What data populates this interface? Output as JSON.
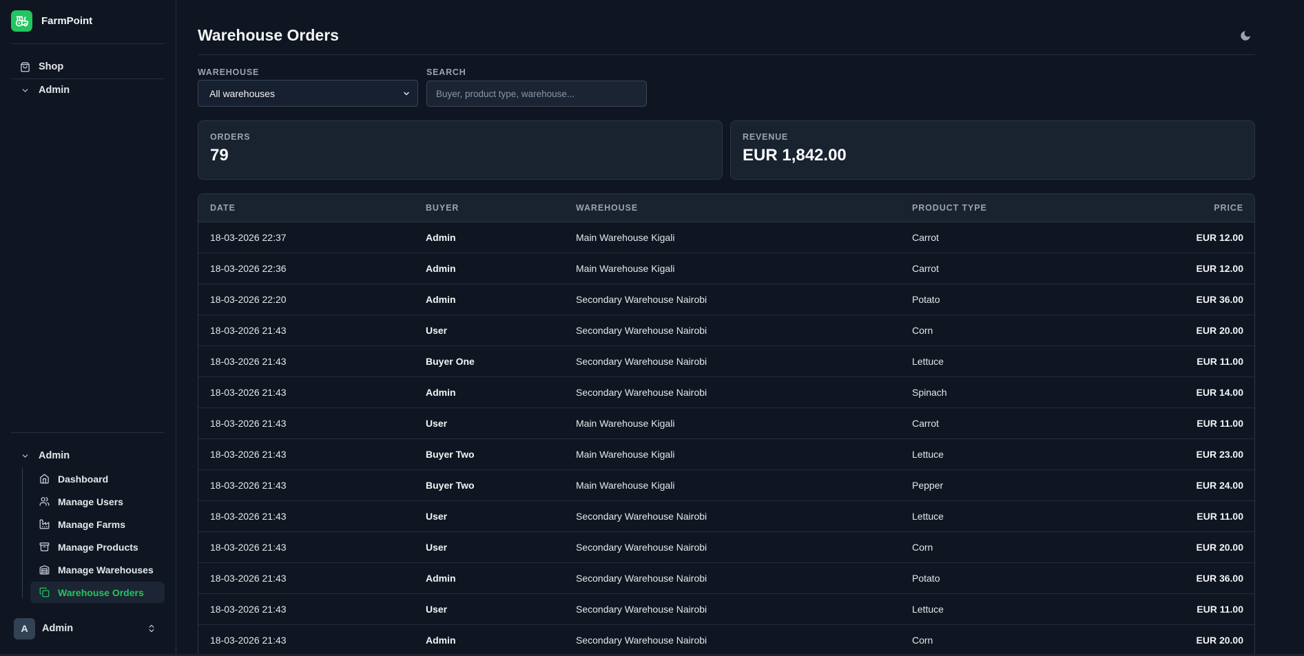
{
  "brand": {
    "name": "FarmPoint"
  },
  "sidebar": {
    "top_items": [
      {
        "label": "Shop"
      },
      {
        "label": "Admin"
      }
    ],
    "section_label": "Admin",
    "sub_items": [
      {
        "label": "Dashboard"
      },
      {
        "label": "Manage Users"
      },
      {
        "label": "Manage Farms"
      },
      {
        "label": "Manage Products"
      },
      {
        "label": "Manage Warehouses"
      },
      {
        "label": "Warehouse Orders"
      }
    ],
    "user": {
      "initial": "A",
      "name": "Admin"
    }
  },
  "page": {
    "title": "Warehouse Orders"
  },
  "filters": {
    "warehouse_label": "WAREHOUSE",
    "warehouse_value": "All warehouses",
    "search_label": "SEARCH",
    "search_placeholder": "Buyer, product type, warehouse..."
  },
  "stats": {
    "orders_label": "ORDERS",
    "orders_value": "79",
    "revenue_label": "REVENUE",
    "revenue_value": "EUR 1,842.00"
  },
  "table": {
    "headers": {
      "date": "DATE",
      "buyer": "BUYER",
      "warehouse": "WAREHOUSE",
      "product_type": "PRODUCT TYPE",
      "price": "PRICE"
    },
    "rows": [
      {
        "date": "18-03-2026 22:37",
        "buyer": "Admin",
        "warehouse": "Main Warehouse Kigali",
        "product_type": "Carrot",
        "price": "EUR 12.00"
      },
      {
        "date": "18-03-2026 22:36",
        "buyer": "Admin",
        "warehouse": "Main Warehouse Kigali",
        "product_type": "Carrot",
        "price": "EUR 12.00"
      },
      {
        "date": "18-03-2026 22:20",
        "buyer": "Admin",
        "warehouse": "Secondary Warehouse Nairobi",
        "product_type": "Potato",
        "price": "EUR 36.00"
      },
      {
        "date": "18-03-2026 21:43",
        "buyer": "User",
        "warehouse": "Secondary Warehouse Nairobi",
        "product_type": "Corn",
        "price": "EUR 20.00"
      },
      {
        "date": "18-03-2026 21:43",
        "buyer": "Buyer One",
        "warehouse": "Secondary Warehouse Nairobi",
        "product_type": "Lettuce",
        "price": "EUR 11.00"
      },
      {
        "date": "18-03-2026 21:43",
        "buyer": "Admin",
        "warehouse": "Secondary Warehouse Nairobi",
        "product_type": "Spinach",
        "price": "EUR 14.00"
      },
      {
        "date": "18-03-2026 21:43",
        "buyer": "User",
        "warehouse": "Main Warehouse Kigali",
        "product_type": "Carrot",
        "price": "EUR 11.00"
      },
      {
        "date": "18-03-2026 21:43",
        "buyer": "Buyer Two",
        "warehouse": "Main Warehouse Kigali",
        "product_type": "Lettuce",
        "price": "EUR 23.00"
      },
      {
        "date": "18-03-2026 21:43",
        "buyer": "Buyer Two",
        "warehouse": "Main Warehouse Kigali",
        "product_type": "Pepper",
        "price": "EUR 24.00"
      },
      {
        "date": "18-03-2026 21:43",
        "buyer": "User",
        "warehouse": "Secondary Warehouse Nairobi",
        "product_type": "Lettuce",
        "price": "EUR 11.00"
      },
      {
        "date": "18-03-2026 21:43",
        "buyer": "User",
        "warehouse": "Secondary Warehouse Nairobi",
        "product_type": "Corn",
        "price": "EUR 20.00"
      },
      {
        "date": "18-03-2026 21:43",
        "buyer": "Admin",
        "warehouse": "Secondary Warehouse Nairobi",
        "product_type": "Potato",
        "price": "EUR 36.00"
      },
      {
        "date": "18-03-2026 21:43",
        "buyer": "User",
        "warehouse": "Secondary Warehouse Nairobi",
        "product_type": "Lettuce",
        "price": "EUR 11.00"
      },
      {
        "date": "18-03-2026 21:43",
        "buyer": "Admin",
        "warehouse": "Secondary Warehouse Nairobi",
        "product_type": "Corn",
        "price": "EUR 20.00"
      }
    ]
  },
  "colors": {
    "accent": "#22c55e",
    "background": "#0f1621",
    "card": "#19222f"
  }
}
